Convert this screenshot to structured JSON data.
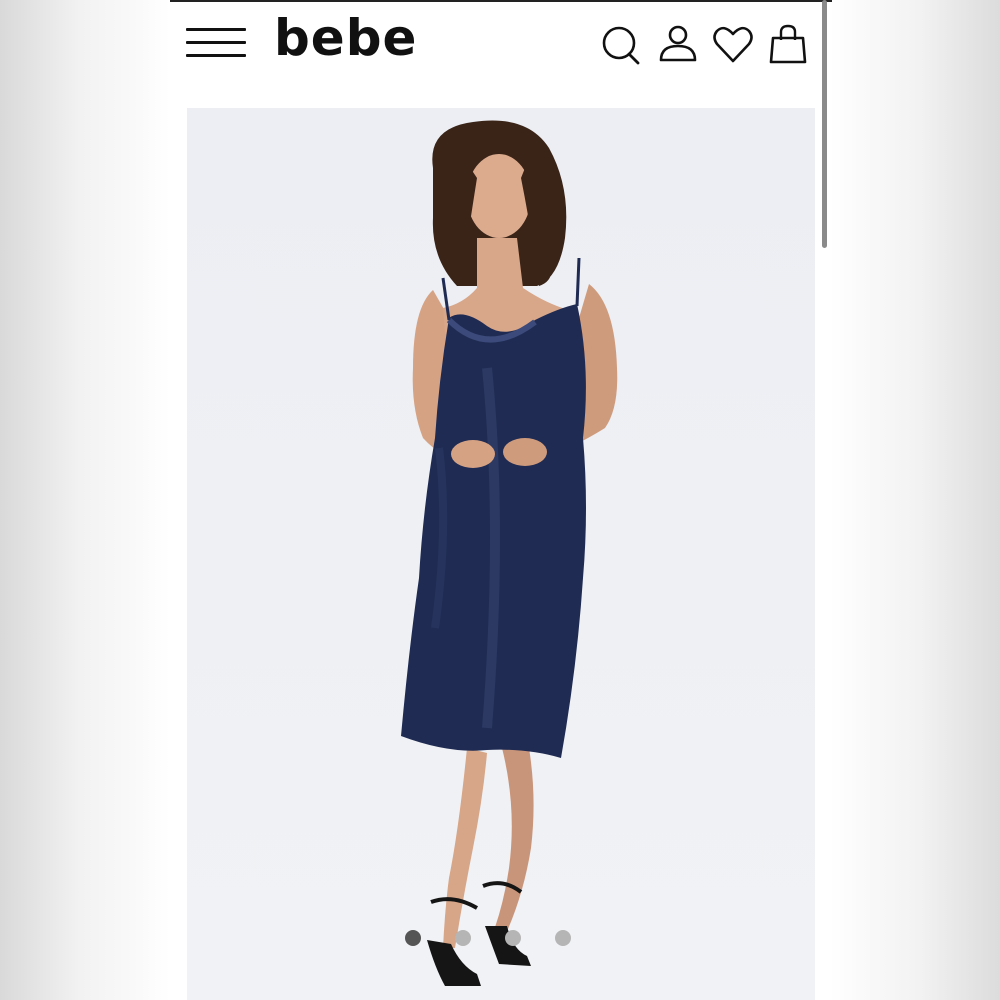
{
  "header": {
    "logo_text": "bebe",
    "icons": [
      "menu-icon",
      "search-icon",
      "account-icon",
      "wishlist-heart-icon",
      "shopping-bag-icon"
    ]
  },
  "gallery": {
    "slide_count": 4,
    "active_index": 0
  },
  "colors": {
    "dress": "#1f2b52",
    "background": "#eef0f4",
    "dot_active": "#555555",
    "dot_inactive": "#b5b5b5"
  }
}
